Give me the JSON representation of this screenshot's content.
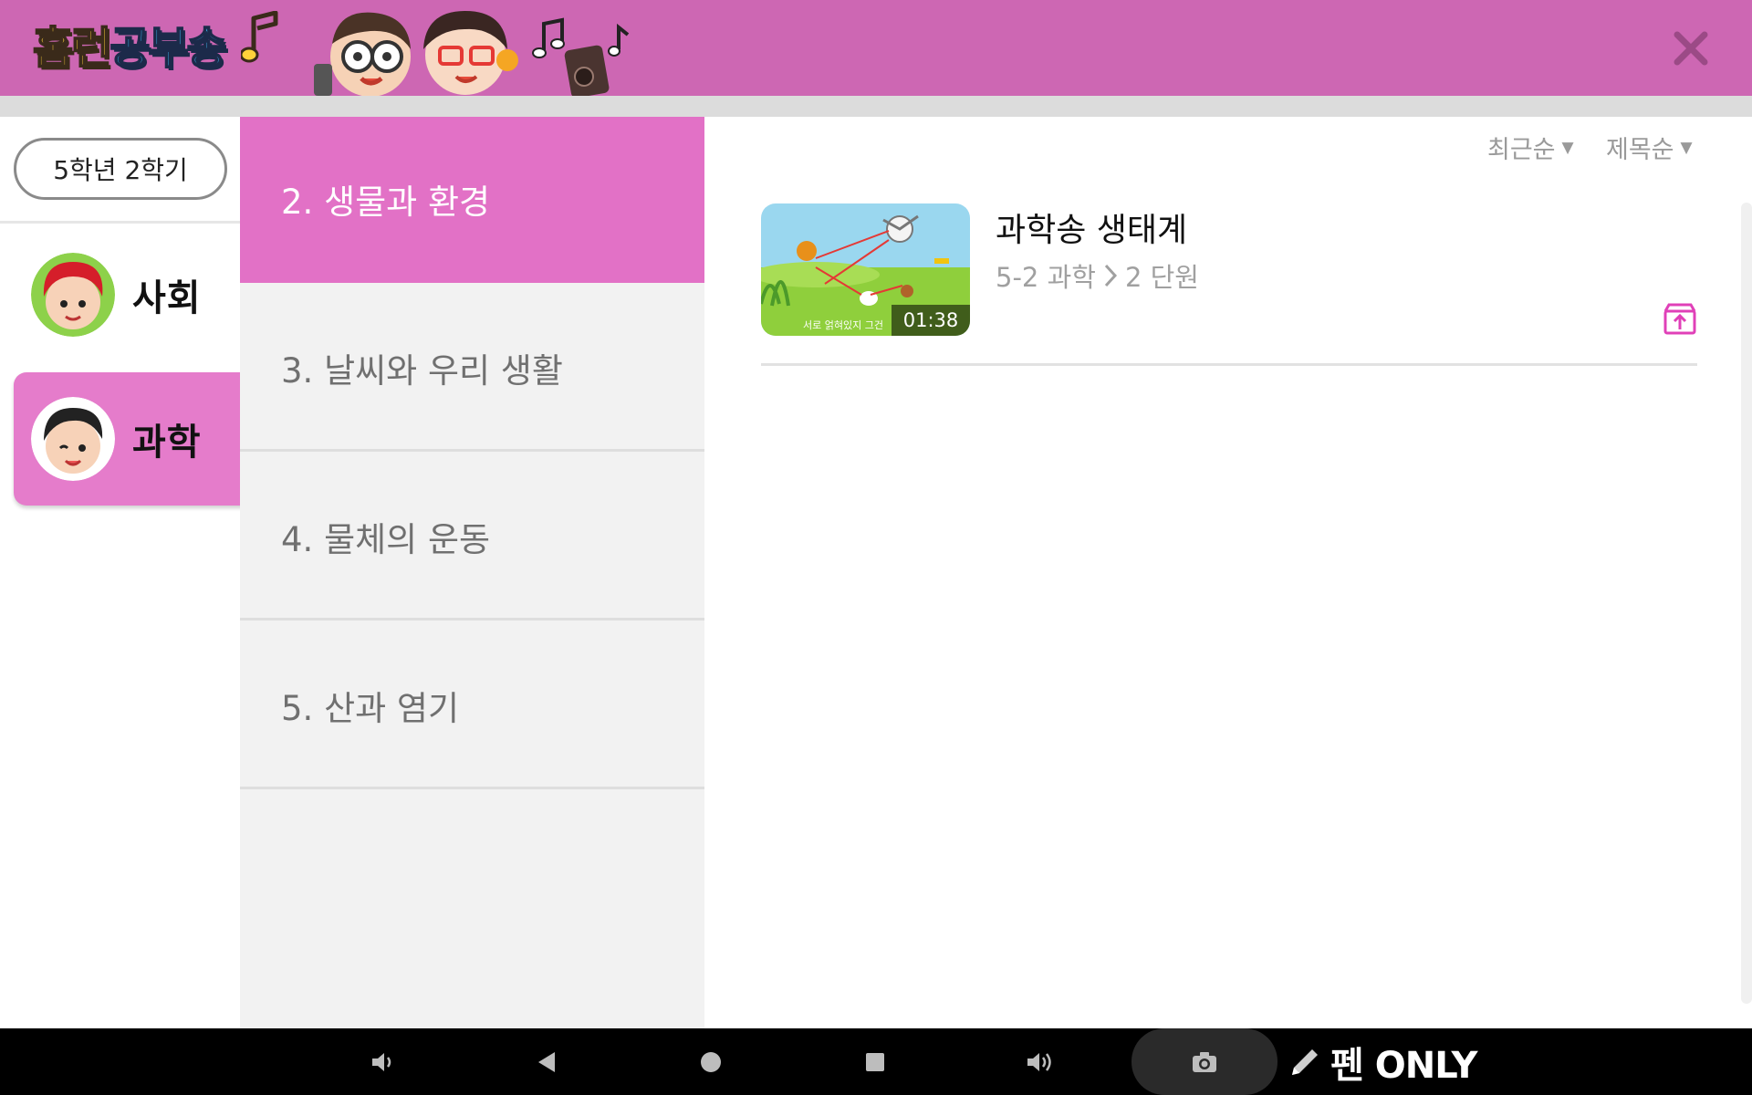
{
  "app": {
    "logo_part1": "홈런",
    "logo_part2": "공부송",
    "close_icon": "close-icon"
  },
  "sidebar": {
    "grade_label": "5학년 2학기",
    "subjects": [
      {
        "label": "사회",
        "icon": "avatar-boy-red-hair",
        "active": false
      },
      {
        "label": "과학",
        "icon": "avatar-boy-black-hair",
        "active": true
      }
    ]
  },
  "chapters": [
    {
      "label": "2. 생물과 환경",
      "active": true
    },
    {
      "label": "3. 날씨와 우리 생활",
      "active": false
    },
    {
      "label": "4. 물체의 운동",
      "active": false
    },
    {
      "label": "5. 산과 염기",
      "active": false
    }
  ],
  "content": {
    "sort_recent": "최근순",
    "sort_title": "제목순",
    "videos": [
      {
        "title": "과학송 생태계",
        "meta_left": "5-2 과학",
        "meta_right": "2 단원",
        "duration": "01:38",
        "thumb_caption": "서로 얽혀있지 그건"
      }
    ]
  },
  "navbar": {
    "pen_label": "펜 ONLY"
  },
  "colors": {
    "header": "#cd67b3",
    "chapter_active": "#e271c6",
    "subject_active": "#e57ccb",
    "accent": "#e040b8"
  }
}
